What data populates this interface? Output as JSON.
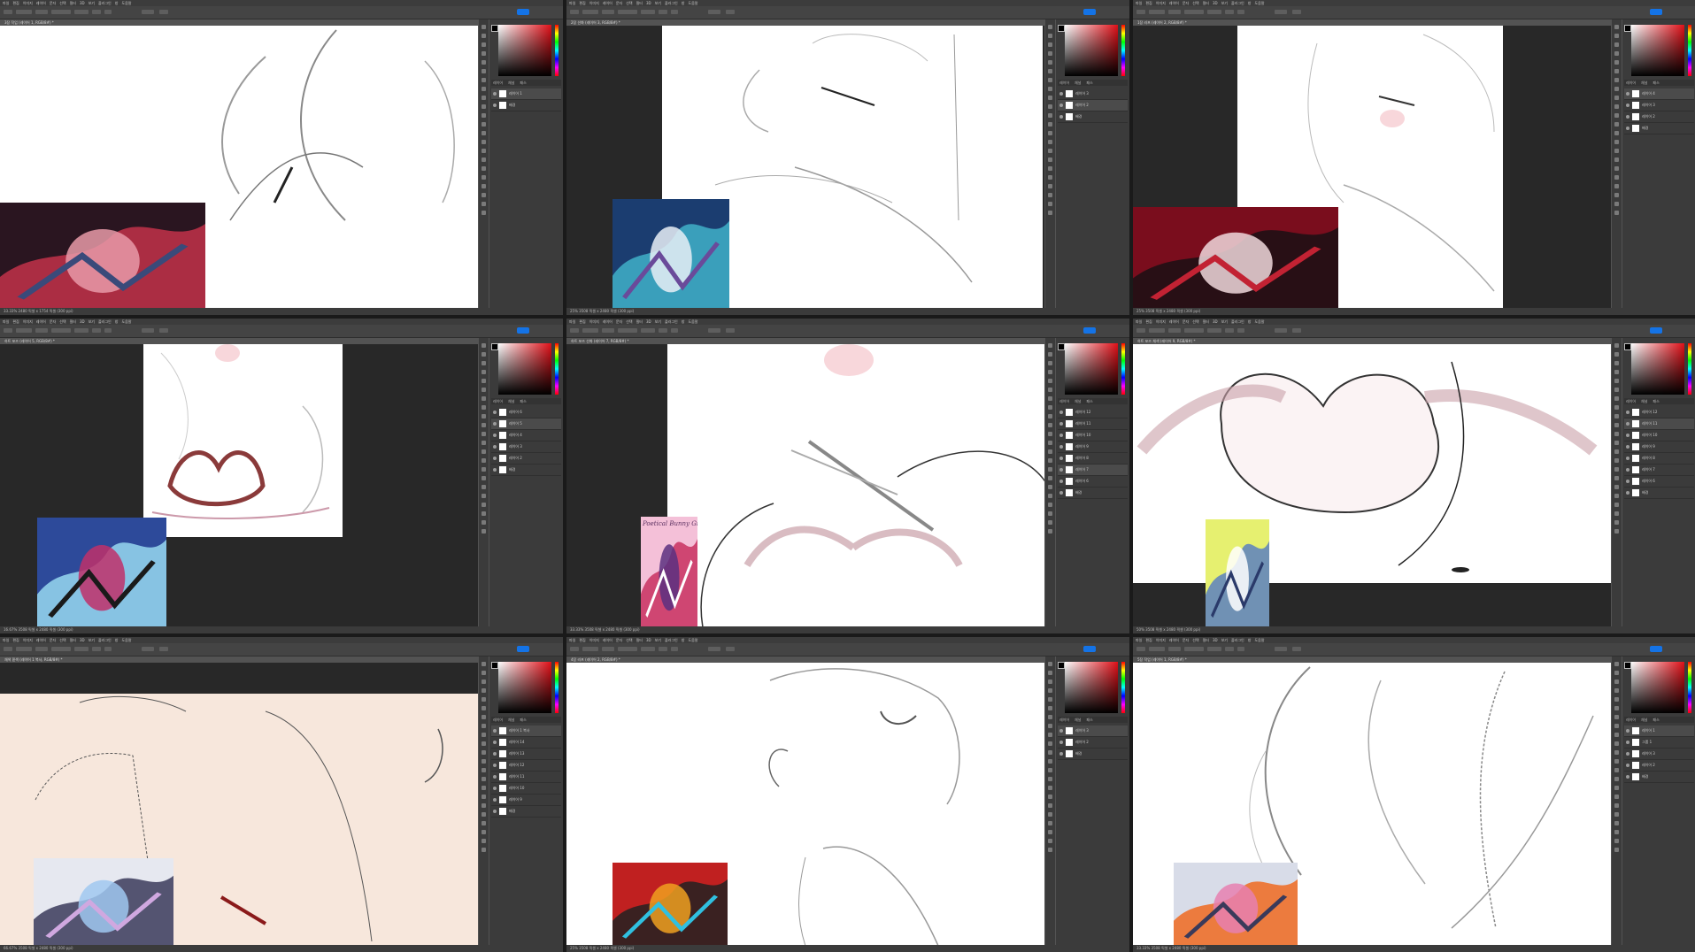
{
  "app": {
    "menu_items": [
      "파일",
      "편집",
      "이미지",
      "레이어",
      "문자",
      "선택",
      "필터",
      "3D",
      "보기",
      "플러그인",
      "창",
      "도움말"
    ]
  },
  "panels": [
    {
      "doc_title": "3장 작업 (레이어 1, RGB/8#) *",
      "status": "33.33% 2480 픽셀 x 1754 픽셀 (300 ppi)",
      "layers": [
        "레이어 1",
        "배경"
      ],
      "selected_layer": 0
    },
    {
      "doc_title": "2장 선화 (레이어 3, RGB/8#) *",
      "status": "25% 3508 픽셀 x 2480 픽셀 (300 ppi)",
      "layers": [
        "레이어 3",
        "레이어 2",
        "배경"
      ],
      "selected_layer": 1
    },
    {
      "doc_title": "1장 러프 (레이어 2, RGB/8#) *",
      "status": "25% 3508 픽셀 x 2480 픽셀 (300 ppi)",
      "layers": [
        "레이어 4",
        "레이어 3",
        "레이어 2",
        "배경"
      ],
      "selected_layer": 0
    },
    {
      "doc_title": "하트 포즈 (레이어 5, RGB/8#) *",
      "status": "16.67% 3508 픽셀 x 2480 픽셀 (300 ppi)",
      "layers": [
        "레이어 6",
        "레이어 5",
        "레이어 4",
        "레이어 3",
        "레이어 2",
        "배경"
      ],
      "selected_layer": 1
    },
    {
      "doc_title": "하트 포즈 선화 (레이어 7, RGB/8#) *",
      "status": "33.33% 3508 픽셀 x 2480 픽셀 (300 ppi)",
      "layers": [
        "레이어 12",
        "레이어 11",
        "레이어 10",
        "레이어 9",
        "레이어 8",
        "레이어 7",
        "레이어 6",
        "배경"
      ],
      "selected_layer": 5
    },
    {
      "doc_title": "하트 포즈 채색 (레이어 9, RGB/8#) *",
      "status": "50% 3508 픽셀 x 2480 픽셀 (300 ppi)",
      "layers": [
        "레이어 12",
        "레이어 11",
        "레이어 10",
        "레이어 9",
        "레이어 8",
        "레이어 7",
        "레이어 6",
        "배경"
      ],
      "selected_layer": 1
    },
    {
      "doc_title": "채색 밑색 (레이어 1 복사, RGB/8#) *",
      "status": "66.67% 3508 픽셀 x 2480 픽셀 (300 ppi)",
      "layers": [
        "레이어 1 복사",
        "레이어 14",
        "레이어 13",
        "레이어 12",
        "레이어 11",
        "레이어 10",
        "레이어 9",
        "배경"
      ],
      "selected_layer": 0
    },
    {
      "doc_title": "4장 러프 (레이어 2, RGB/8#) *",
      "status": "25% 3508 픽셀 x 2480 픽셀 (300 ppi)",
      "layers": [
        "레이어 3",
        "레이어 2",
        "배경"
      ],
      "selected_layer": 0
    },
    {
      "doc_title": "5장 작업 (레이어 1, RGB/8#) *",
      "status": "33.33% 3508 픽셀 x 2480 픽셀 (300 ppi)",
      "layers": [
        "레이어 1",
        "그룹 1",
        "레이어 3",
        "레이어 2",
        "배경"
      ],
      "selected_layer": 0
    }
  ],
  "references": [
    {
      "name": "ref-dark-red-battle",
      "colors": [
        "#2a1520",
        "#c2314a",
        "#e89aa8",
        "#3a4a7a"
      ]
    },
    {
      "name": "ref-blue-dragon",
      "colors": [
        "#1b3d70",
        "#3fb0c8",
        "#e8eef6",
        "#6a4a9a"
      ]
    },
    {
      "name": "ref-red-beast",
      "colors": [
        "#7a0d1d",
        "#1a1014",
        "#f0d8dc",
        "#c22233"
      ]
    },
    {
      "name": "ref-blue-hair-angel",
      "colors": [
        "#2d4a9a",
        "#98d8f0",
        "#c0306a",
        "#1a1a1a"
      ]
    },
    {
      "name": "ref-pink-girl",
      "colors": [
        "#f4c0d8",
        "#c83060",
        "#5a3080",
        "#ffffff"
      ],
      "text": "Poetical Bunny Girl"
    },
    {
      "name": "ref-yellow-poster",
      "colors": [
        "#e6f070",
        "#5a80c0",
        "#ffffff",
        "#2a3a6a"
      ]
    },
    {
      "name": "ref-silver-halo",
      "colors": [
        "#e6e8f0",
        "#3a3a5a",
        "#a0c8f0",
        "#d0a8e0"
      ]
    },
    {
      "name": "ref-red-mech",
      "colors": [
        "#c02020",
        "#222222",
        "#f0a020",
        "#30c0e0"
      ]
    },
    {
      "name": "ref-explosion-duo",
      "colors": [
        "#d8dce8",
        "#f06a20",
        "#e880b0",
        "#3a3a5a"
      ]
    }
  ]
}
